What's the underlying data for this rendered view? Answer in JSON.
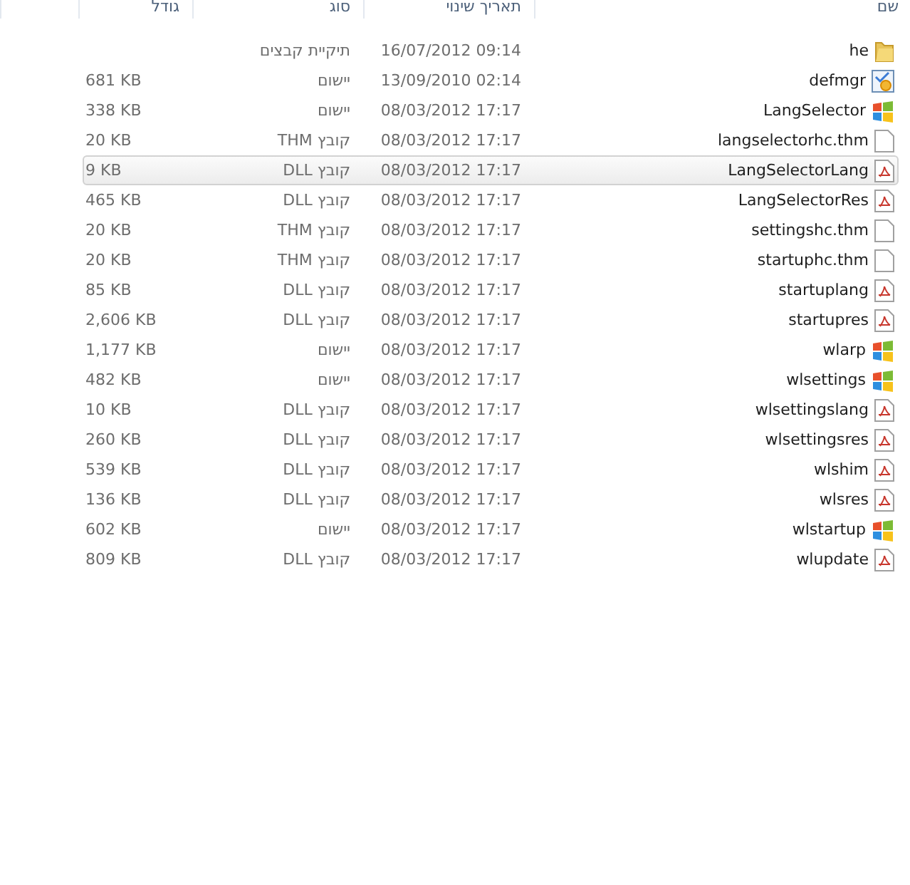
{
  "columns": [
    {
      "label": "שם"
    },
    {
      "label": "תאריך שינוי"
    },
    {
      "label": "סוג"
    },
    {
      "label": "גודל"
    }
  ],
  "rows": [
    {
      "name": "he",
      "kind": "folder",
      "date": "16/07/2012 09:14",
      "type": "תיקיית קבצים",
      "selected": false
    },
    {
      "name": "defmgr",
      "kind": "tool",
      "date": "13/09/2010 02:14",
      "type": "יישום",
      "size": "681 KB",
      "selected": false
    },
    {
      "name": "LangSelector",
      "kind": "app",
      "date": "08/03/2012 17:17",
      "type": "יישום",
      "size": "338 KB",
      "selected": false
    },
    {
      "name": "langselectorhc.thm",
      "kind": "blank",
      "date": "08/03/2012 17:17",
      "type": "קובץ THM",
      "size": "20 KB",
      "selected": false
    },
    {
      "name": "LangSelectorLang",
      "kind": "dll",
      "date": "08/03/2012 17:17",
      "type": "קובץ DLL",
      "size": "9 KB",
      "selected": true
    },
    {
      "name": "LangSelectorRes",
      "kind": "dll",
      "date": "08/03/2012 17:17",
      "type": "קובץ DLL",
      "size": "465 KB",
      "selected": false
    },
    {
      "name": "settingshc.thm",
      "kind": "blank",
      "date": "08/03/2012 17:17",
      "type": "קובץ THM",
      "size": "20 KB",
      "selected": false
    },
    {
      "name": "startuphc.thm",
      "kind": "blank",
      "date": "08/03/2012 17:17",
      "type": "קובץ THM",
      "size": "20 KB",
      "selected": false
    },
    {
      "name": "startuplang",
      "kind": "dll",
      "date": "08/03/2012 17:17",
      "type": "קובץ DLL",
      "size": "85 KB",
      "selected": false
    },
    {
      "name": "startupres",
      "kind": "dll",
      "date": "08/03/2012 17:17",
      "type": "קובץ DLL",
      "size": "2,606 KB",
      "selected": false
    },
    {
      "name": "wlarp",
      "kind": "app",
      "date": "08/03/2012 17:17",
      "type": "יישום",
      "size": "1,177 KB",
      "selected": false
    },
    {
      "name": "wlsettings",
      "kind": "app",
      "date": "08/03/2012 17:17",
      "type": "יישום",
      "size": "482 KB",
      "selected": false
    },
    {
      "name": "wlsettingslang",
      "kind": "dll",
      "date": "08/03/2012 17:17",
      "type": "קובץ DLL",
      "size": "10 KB",
      "selected": false
    },
    {
      "name": "wlsettingsres",
      "kind": "dll",
      "date": "08/03/2012 17:17",
      "type": "קובץ DLL",
      "size": "260 KB",
      "selected": false
    },
    {
      "name": "wlshim",
      "kind": "dll",
      "date": "08/03/2012 17:17",
      "type": "קובץ DLL",
      "size": "539 KB",
      "selected": false
    },
    {
      "name": "wlsres",
      "kind": "dll",
      "date": "08/03/2012 17:17",
      "type": "קובץ DLL",
      "size": "136 KB",
      "selected": false
    },
    {
      "name": "wlstartup",
      "kind": "app",
      "date": "08/03/2012 17:17",
      "type": "יישום",
      "size": "602 KB",
      "selected": false
    },
    {
      "name": "wlupdate",
      "kind": "dll",
      "date": "08/03/2012 17:17",
      "type": "קובץ DLL",
      "size": "809 KB",
      "selected": false
    }
  ]
}
